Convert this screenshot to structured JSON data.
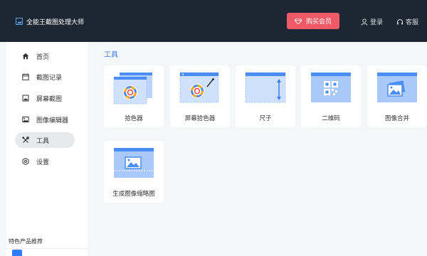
{
  "app": {
    "title": "全能王截图处理大师",
    "logo_icon": "picture-icon"
  },
  "header": {
    "buy_label": "购买会员",
    "buy_icon": "diamond-icon",
    "login_label": "登录",
    "service_label": "客服",
    "accent_color": "#f05a66",
    "bg_color": "#1d2733"
  },
  "sidebar": {
    "items": [
      {
        "label": "首页",
        "icon": "home-icon"
      },
      {
        "label": "截图记录",
        "icon": "calendar-icon"
      },
      {
        "label": "屏幕截图",
        "icon": "crop-icon"
      },
      {
        "label": "图像编辑器",
        "icon": "image-icon"
      },
      {
        "label": "工具",
        "icon": "tools-icon",
        "active": true
      },
      {
        "label": "设置",
        "icon": "settings-icon"
      }
    ],
    "recommend_title": "特色产品推荐"
  },
  "main": {
    "section_title": "工具",
    "tools": [
      {
        "label": "拾色器",
        "icon": "color-wheel-icon"
      },
      {
        "label": "屏幕拾色器",
        "icon": "screen-color-picker-icon"
      },
      {
        "label": "尺子",
        "icon": "ruler-icon"
      },
      {
        "label": "二维码",
        "icon": "qr-code-icon"
      },
      {
        "label": "图像合并",
        "icon": "image-merge-icon"
      },
      {
        "label": "生成图像缩略图",
        "icon": "thumbnail-icon"
      }
    ],
    "accent_color": "#3a7df4"
  }
}
